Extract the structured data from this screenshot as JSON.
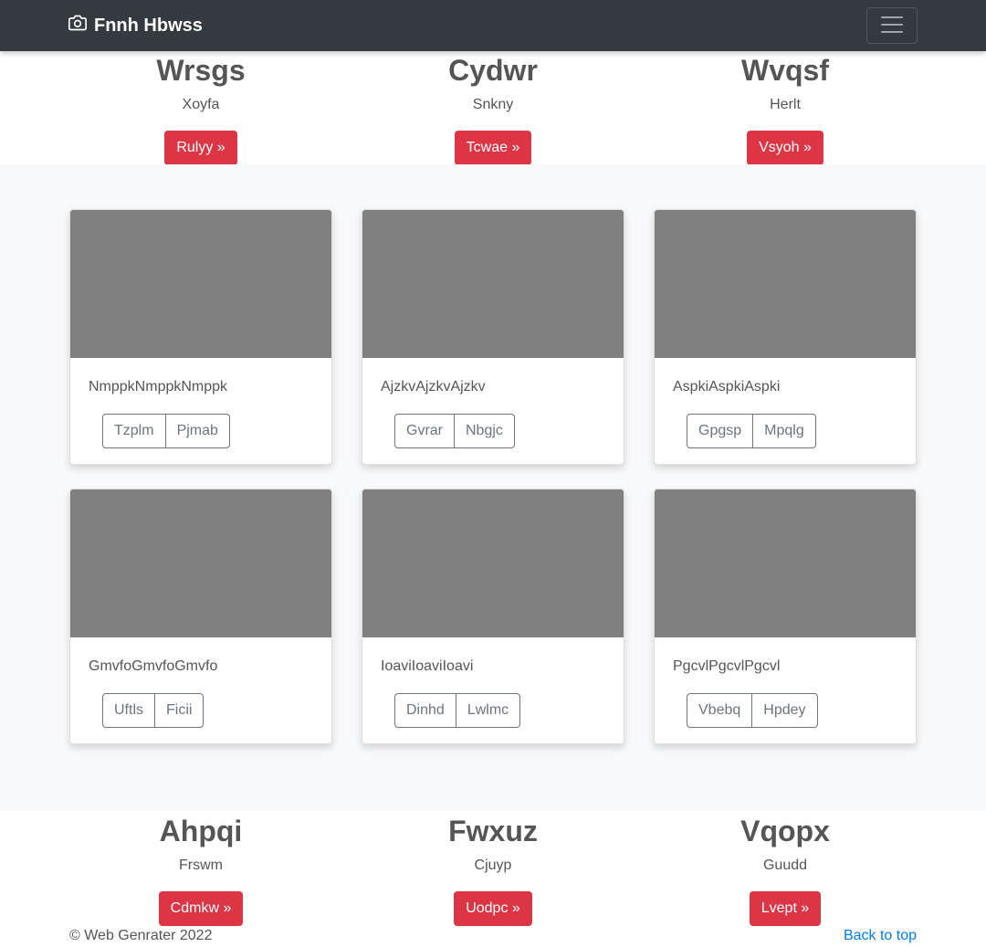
{
  "navbar": {
    "brand": "Fnnh Hbwss",
    "brand_icon": "camera-icon",
    "toggler_icon": "hamburger-menu-icon"
  },
  "top_features": [
    {
      "heading": "Wrsgs",
      "text": "Xoyfa",
      "button": "Rulyy »"
    },
    {
      "heading": "Cydwr",
      "text": "Snkny",
      "button": "Tcwae »"
    },
    {
      "heading": "Wvqsf",
      "text": "Herlt",
      "button": "Vsyoh »"
    }
  ],
  "cards": [
    {
      "text": "NmppkNmppkNmppk",
      "btn1": "Tzplm",
      "btn2": "Pjmab"
    },
    {
      "text": "AjzkvAjzkvAjzkv",
      "btn1": "Gvrar",
      "btn2": "Nbgjc"
    },
    {
      "text": "AspkiAspkiAspki",
      "btn1": "Gpgsp",
      "btn2": "Mpqlg"
    },
    {
      "text": "GmvfoGmvfoGmvfo",
      "btn1": "Uftls",
      "btn2": "Ficii"
    },
    {
      "text": "IoaviIoaviIoavi",
      "btn1": "Dinhd",
      "btn2": "Lwlmc"
    },
    {
      "text": "PgcvlPgcvlPgcvl",
      "btn1": "Vbebq",
      "btn2": "Hpdey"
    }
  ],
  "bottom_features": [
    {
      "heading": "Ahpqi",
      "text": "Frswm",
      "button": "Cdmkw »"
    },
    {
      "heading": "Fwxuz",
      "text": "Cjuyp",
      "button": "Uodpc »"
    },
    {
      "heading": "Vqopx",
      "text": "Guudd",
      "button": "Lvept »"
    }
  ],
  "footer": {
    "copyright": "© Web Genrater 2022",
    "back_to_top": "Back to top"
  },
  "colors": {
    "navbar": "#343a40",
    "accent_red": "#dc3545",
    "link_blue": "#007bff",
    "thumbnail_gray": "#808080",
    "album_bg": "#f8f9fa"
  }
}
